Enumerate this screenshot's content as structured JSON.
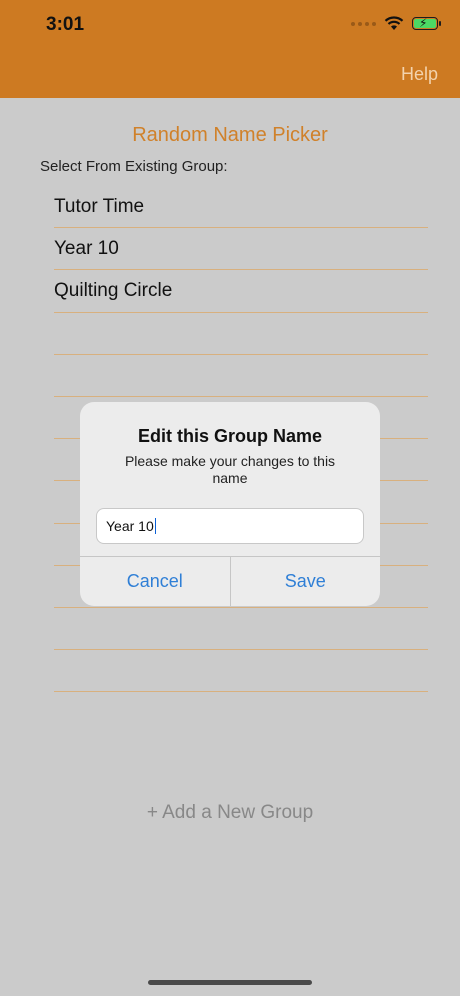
{
  "status_bar": {
    "time": "3:01",
    "icons": [
      "cellular-dots-icon",
      "wifi-icon",
      "battery-charging-icon"
    ],
    "bg_color": "#cd7a22"
  },
  "nav": {
    "help_label": "Help"
  },
  "main": {
    "title": "Random Name Picker",
    "select_label": "Select From Existing Group:",
    "groups": [
      "Tutor Time",
      "Year 10",
      "Quilting Circle",
      "",
      "",
      "",
      "",
      "",
      "",
      "",
      "",
      ""
    ],
    "add_group_label": "+ Add a New Group"
  },
  "dialog": {
    "title": "Edit this Group Name",
    "message": "Please make your changes to this name",
    "input_value": "Year 10",
    "cancel_label": "Cancel",
    "save_label": "Save"
  },
  "colors": {
    "accent_orange": "#d0812a",
    "button_blue": "#2f7fd6",
    "background_gray": "#cbcbcb"
  }
}
